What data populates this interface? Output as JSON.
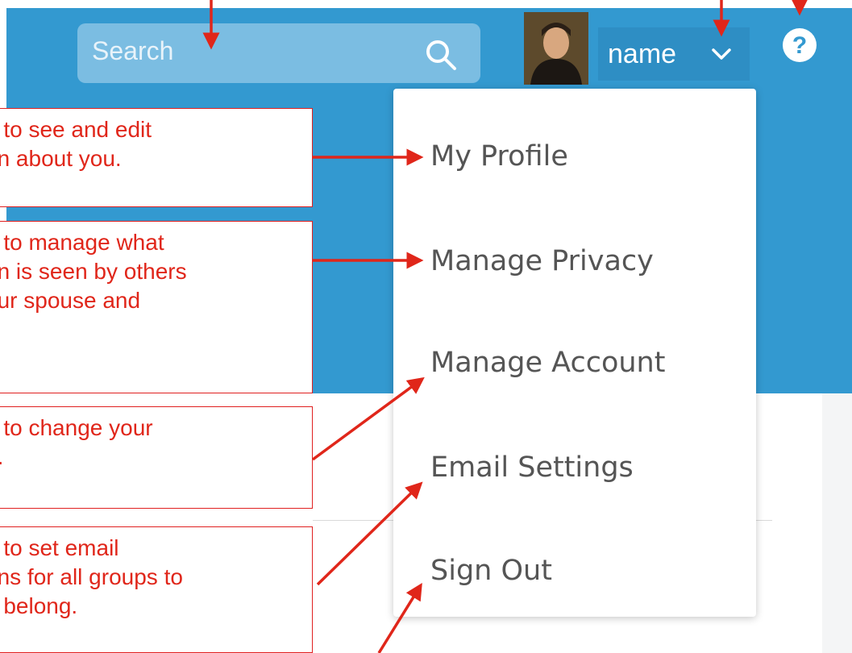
{
  "search": {
    "placeholder": "Search",
    "icon": "search-icon"
  },
  "user": {
    "name": "name",
    "avatar_icon": "portrait-avatar",
    "dropdown_icon": "chevron-down-icon"
  },
  "help": {
    "icon": "help-icon",
    "glyph": "?"
  },
  "menu": {
    "items": [
      {
        "label": "My Profile"
      },
      {
        "label": "Manage Privacy"
      },
      {
        "label": "Manage Account"
      },
      {
        "label": "Email Settings"
      },
      {
        "label": "Sign Out"
      }
    ]
  },
  "callouts": [
    {
      "text": "e to see and edit\non about you."
    },
    {
      "text": "e to manage what\non is seen by others\nour spouse and"
    },
    {
      "text": "e to change your\nd."
    },
    {
      "text": "e to set email\nons for all groups to\nu belong."
    }
  ],
  "colors": {
    "header": "#3399d0",
    "annotation": "#e0261a",
    "menu_text": "#555555"
  }
}
